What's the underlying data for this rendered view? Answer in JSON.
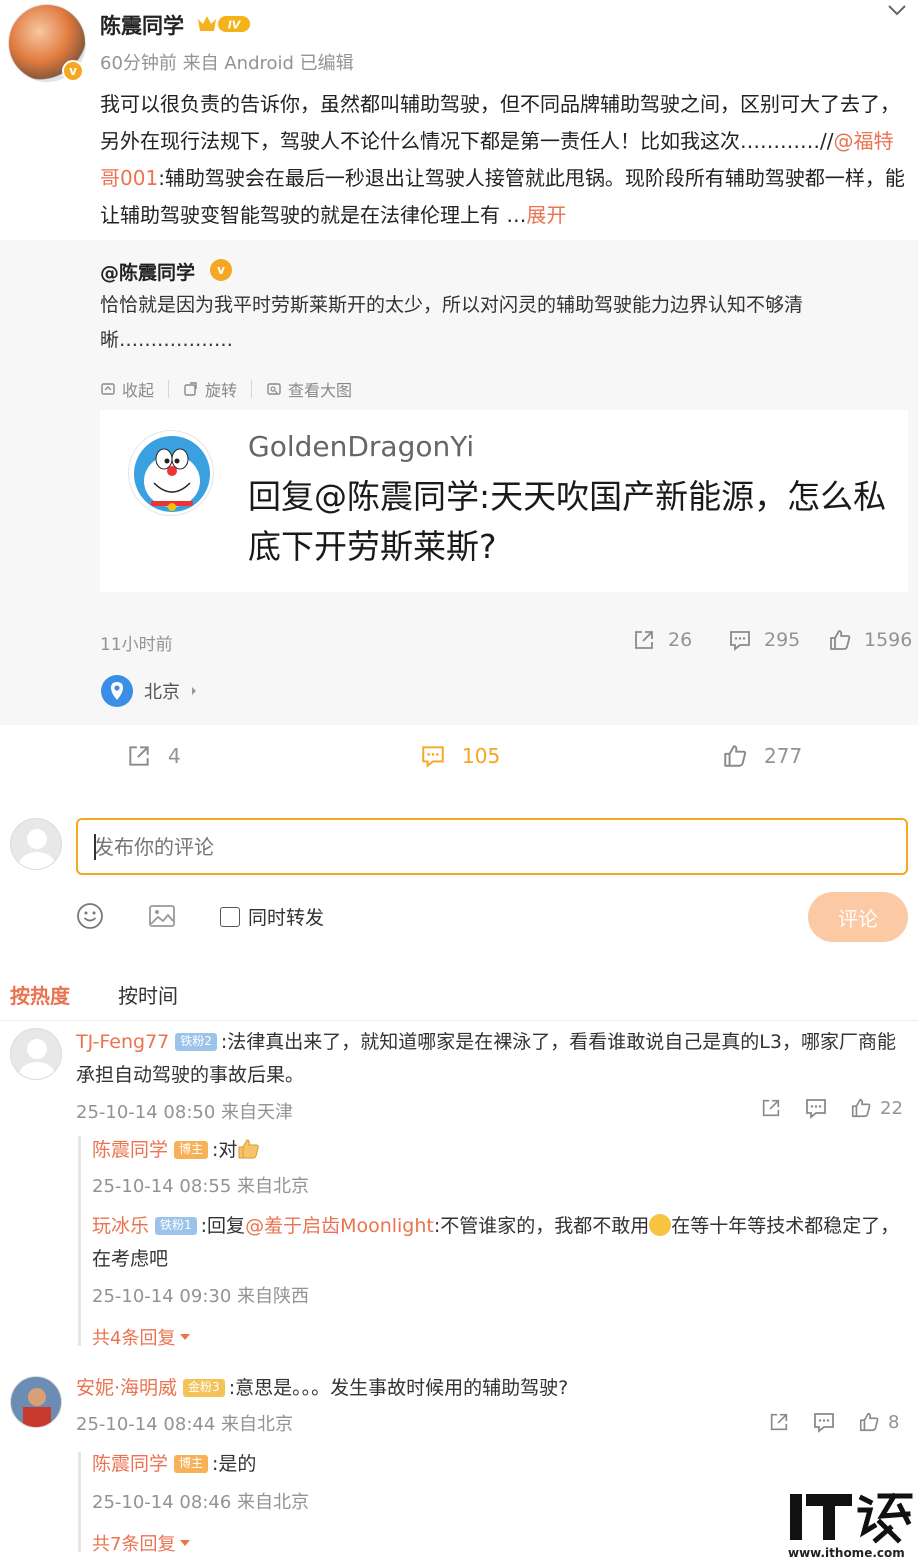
{
  "post": {
    "author": "陈震同学",
    "level": "IV",
    "verified_mark": "v",
    "meta": "60分钟前  来自 Android 已编辑",
    "text_part1": "我可以很负责的告诉你，虽然都叫辅助驾驶，但不同品牌辅助驾驶之间，区别可大了去了，另外在现行法规下，驾驶人不论什么情况下都是第一责任人！比如我这次…………//",
    "mention": "@福特哥001",
    "text_part2": ":辅助驾驶会在最后一秒退出让驾驶人接管就此甩锅。现阶段所有辅助驾驶都一样，能让辅助驾驶变智能驾驶的就是在法律伦理上有 …",
    "expand": "展开"
  },
  "repost": {
    "author": "@陈震同学",
    "text": "恰恰就是因为我平时劳斯莱斯开的太少，所以对闪灵的辅助驾驶能力边界认知不够清晰………………",
    "tools": [
      "收起",
      "旋转",
      "查看大图"
    ],
    "image_user": "GoldenDragonYi",
    "image_reply": "回复@陈震同学:天天吹国产新能源，怎么私底下开劳斯莱斯?",
    "time": "11小时前",
    "shares": "26",
    "comments": "295",
    "likes": "1596",
    "location": "北京"
  },
  "actions": {
    "shares": "4",
    "comments": "105",
    "likes": "277"
  },
  "compose": {
    "placeholder": "发布你的评论",
    "sync_label": "同时转发",
    "submit_label": "评论"
  },
  "sort": {
    "hot": "按热度",
    "time": "按时间"
  },
  "comments": [
    {
      "name": "TJ-Feng77",
      "badge": "铁粉2",
      "text": ":法律真出来了，就知道哪家是在裸泳了，看看谁敢说自己是真的L3，哪家厂商能承担自动驾驶的事故后果。",
      "meta": "25-10-14 08:50 来自天津",
      "likes": "22",
      "replies": [
        {
          "name": "陈震同学",
          "badge": "博主",
          "text": ":对",
          "meta": "25-10-14 08:55 来自北京"
        },
        {
          "name": "玩冰乐",
          "badge": "铁粉1",
          "mention": "@羞于启齿Moonlight",
          "text_pre": ":回复",
          "text": ":不管谁家的，我都不敢用",
          "text_post": "在等十年等技术都稳定了，在考虑吧",
          "meta": "25-10-14 09:30 来自陕西"
        }
      ],
      "more": "共4条回复"
    },
    {
      "name": "安妮·海明威",
      "badge": "金粉3",
      "text": ":意思是。。。发生事故时候用的辅助驾驶?",
      "meta": "25-10-14 08:44 来自北京",
      "likes": "8",
      "replies": [
        {
          "name": "陈震同学",
          "badge": "博主",
          "text": ":是的",
          "meta": "25-10-14 08:46 来自北京"
        }
      ],
      "more": "共7条回复"
    }
  ],
  "watermark": {
    "logo_text": "IT之家",
    "site": "www.ithome.com"
  },
  "colors": {
    "accent": "#eb7350",
    "input_border": "#f5a623",
    "muted": "#939393"
  },
  "icons": [
    "share-icon",
    "comment-icon",
    "like-icon",
    "location-pin-icon",
    "emoji-icon",
    "image-icon",
    "chevron-down-icon"
  ]
}
